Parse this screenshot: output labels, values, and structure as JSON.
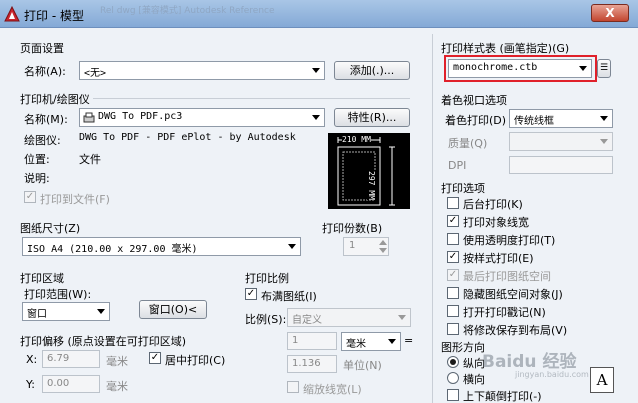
{
  "window": {
    "title": "打印 - 模型",
    "close_label": "X",
    "background_text": "Rel          dwg [兼容模式]            Autodesk                    Reference"
  },
  "page_setup": {
    "group_label": "页面设置",
    "name_label": "名称(A):",
    "name_value": "<无>",
    "add_button": "添加(.)..."
  },
  "printer": {
    "group_label": "打印机/绘图仪",
    "name_label": "名称(M):",
    "name_value": "DWG To PDF.pc3",
    "properties_button": "特性(R)...",
    "plotter_label": "绘图仪:",
    "plotter_value": "DWG To PDF - PDF ePlot - by Autodesk",
    "location_label": "位置:",
    "location_value": "文件",
    "description_label": "说明:",
    "plot_to_file_label": "打印到文件(F)",
    "preview_width": "210 MM",
    "preview_height": "297 MM"
  },
  "paper_size": {
    "group_label": "图纸尺寸(Z)",
    "value": "ISO A4 (210.00 x 297.00 毫米)"
  },
  "copies": {
    "group_label": "打印份数(B)",
    "value": "1"
  },
  "plot_area": {
    "group_label": "打印区域",
    "range_label": "打印范围(W):",
    "range_value": "窗口",
    "window_button": "窗口(O)<"
  },
  "plot_offset": {
    "group_label": "打印偏移 (原点设置在可打印区域)",
    "x_label": "X:",
    "x_value": "6.79",
    "x_unit": "毫米",
    "y_label": "Y:",
    "y_value": "0.00",
    "y_unit": "毫米",
    "center_label": "居中打印(C)"
  },
  "plot_scale": {
    "group_label": "打印比例",
    "fit_label": "布满图纸(I)",
    "scale_label": "比例(S):",
    "scale_value": "自定义",
    "value1": "1",
    "unit_value": "毫米",
    "equals": "=",
    "value2": "1.136",
    "unit2_label": "单位(N)",
    "lineweight_label": "缩放线宽(L)"
  },
  "plot_style": {
    "group_label": "打印样式表 (画笔指定)(G)",
    "value": "monochrome.ctb",
    "edit_icon_label": "☰"
  },
  "shaded_viewport": {
    "group_label": "着色视口选项",
    "shade_label": "着色打印(D)",
    "shade_value": "传统线框",
    "quality_label": "质量(Q)",
    "dpi_label": "DPI"
  },
  "plot_options": {
    "group_label": "打印选项",
    "items": [
      {
        "label": "后台打印(K)",
        "checked": "",
        "disabled": false
      },
      {
        "label": "打印对象线宽",
        "checked": "✓",
        "disabled": false
      },
      {
        "label": "使用透明度打印(T)",
        "checked": "",
        "disabled": false
      },
      {
        "label": "按样式打印(E)",
        "checked": "✓",
        "disabled": false
      },
      {
        "label": "最后打印图纸空间",
        "checked": "✓",
        "disabled": true
      },
      {
        "label": "隐藏图纸空间对象(J)",
        "checked": "",
        "disabled": false
      },
      {
        "label": "打开打印戳记(N)",
        "checked": "",
        "disabled": false
      },
      {
        "label": "将修改保存到布局(V)",
        "checked": "",
        "disabled": false
      }
    ]
  },
  "orientation": {
    "group_label": "图形方向",
    "portrait_label": "纵向",
    "landscape_label": "横向",
    "upside_down_label": "上下颠倒打印(-)",
    "icon_letter": "A"
  },
  "watermark": {
    "text": "Baidu 经验",
    "sub_text": "jingyan.baidu.com"
  },
  "colors": {
    "highlight": "#e0202a",
    "accent": "#1d58a7"
  }
}
